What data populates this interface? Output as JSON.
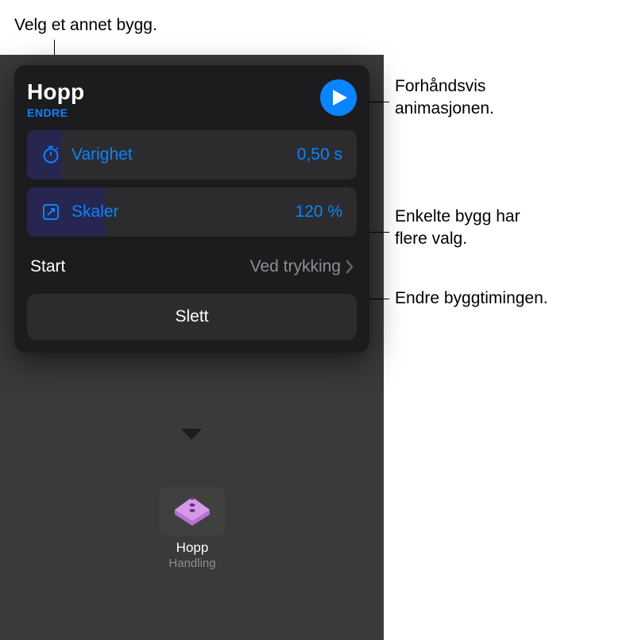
{
  "callouts": {
    "top": "Velg et annet bygg.",
    "preview": "Forhåndsvis\nanimasjonen.",
    "options": "Enkelte bygg har\nflere valg.",
    "timing": "Endre byggtimingen."
  },
  "popover": {
    "title": "Hopp",
    "change": "ENDRE",
    "duration": {
      "label": "Varighet",
      "value": "0,50 s"
    },
    "scale": {
      "label": "Skaler",
      "value": "120 %"
    },
    "start": {
      "label": "Start",
      "value": "Ved trykking"
    },
    "delete": "Slett"
  },
  "thumb": {
    "label": "Hopp",
    "sublabel": "Handling"
  }
}
